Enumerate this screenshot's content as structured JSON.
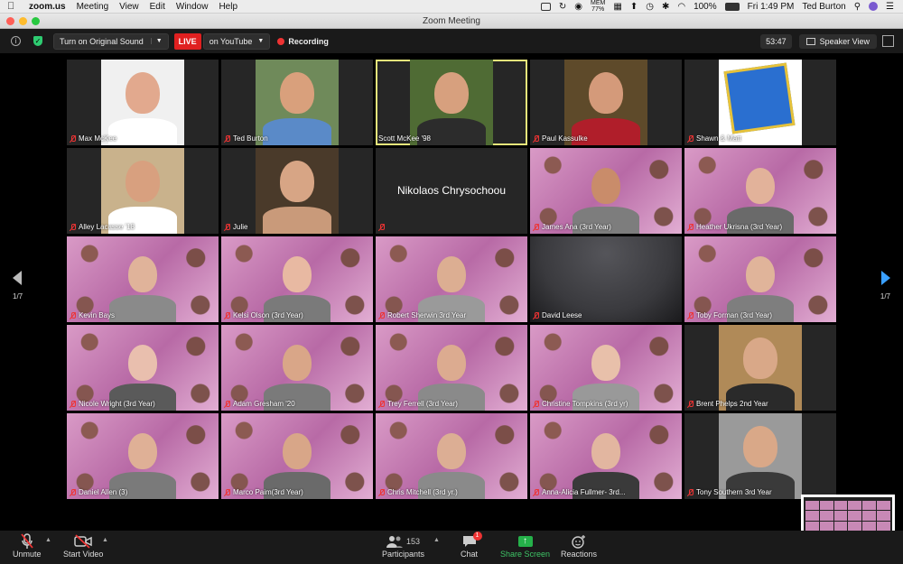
{
  "menubar": {
    "app": "zoom.us",
    "items": [
      "Meeting",
      "View",
      "Edit",
      "Window",
      "Help"
    ],
    "battery": "100%",
    "mem_label": "MEM",
    "mem_value": "77%",
    "clock": "Fri 1:49 PM",
    "user": "Ted Burton"
  },
  "window": {
    "title": "Zoom Meeting"
  },
  "topbar": {
    "original_sound": "Turn on Original Sound",
    "live": "LIVE",
    "youtube": "on YouTube",
    "recording": "Recording",
    "timer": "53:47",
    "speaker_view": "Speaker View"
  },
  "participants": [
    {
      "name": "Max McKee",
      "style": "photo",
      "muted": true,
      "active": false,
      "bg": "#f0f0f0",
      "skin": "#e2a98e",
      "shirt": "#ffffff"
    },
    {
      "name": "Ted Burton",
      "style": "photo",
      "muted": true,
      "active": false,
      "bg": "#6f8a5a",
      "skin": "#d9a07c",
      "shirt": "#5a8ac8"
    },
    {
      "name": "Scott McKee '98",
      "style": "photo",
      "muted": false,
      "active": true,
      "bg": "#4f6b34",
      "skin": "#d7a07e",
      "shirt": "#2c2c2c"
    },
    {
      "name": "Paul Kassulke",
      "style": "photo",
      "muted": true,
      "active": false,
      "bg": "#5e4a2a",
      "skin": "#d49a7a",
      "shirt": "#b01e2a"
    },
    {
      "name": "Shawn & Matt",
      "style": "blocks",
      "muted": true,
      "active": false,
      "bg": "#ffffff",
      "skin": "#e6c23a",
      "shirt": "#2a6fd0"
    },
    {
      "name": "Alley Lacasse '18",
      "style": "photo",
      "muted": true,
      "active": false,
      "bg": "#c9b28c",
      "skin": "#d8a07f",
      "shirt": "#ffffff"
    },
    {
      "name": "Julie",
      "style": "photo",
      "muted": true,
      "active": false,
      "bg": "#4a3a2a",
      "skin": "#d7a585",
      "shirt": "#c99a7a"
    },
    {
      "name": "Nikolaos Chrysochoou",
      "style": "text",
      "muted": true,
      "active": false,
      "bg": "#262626",
      "skin": "",
      "shirt": ""
    },
    {
      "name": "James Ana (3rd Year)",
      "style": "pink",
      "muted": true,
      "active": false,
      "bg": "",
      "skin": "#c98c6a",
      "shirt": "#7d7d7d"
    },
    {
      "name": "Heather Ukrisna (3rd Year)",
      "style": "pink",
      "muted": true,
      "active": false,
      "bg": "",
      "skin": "#e2b29a",
      "shirt": "#6a6a6a"
    },
    {
      "name": "Kevin Bays",
      "style": "pink",
      "muted": true,
      "active": false,
      "bg": "",
      "skin": "#e0b39a",
      "shirt": "#8a8a8a"
    },
    {
      "name": "Kelsi Olson (3rd Year)",
      "style": "pink",
      "muted": true,
      "active": false,
      "bg": "",
      "skin": "#e8b9a2",
      "shirt": "#7a7a7a"
    },
    {
      "name": "Robert Sherwin 3rd Year",
      "style": "pink",
      "muted": true,
      "active": false,
      "bg": "",
      "skin": "#dcae92",
      "shirt": "#9a9a9a"
    },
    {
      "name": "David Leese",
      "style": "dark",
      "muted": true,
      "active": false,
      "bg": "#3a3a3e",
      "skin": "",
      "shirt": ""
    },
    {
      "name": "Toby Forman (3rd Year)",
      "style": "pink",
      "muted": true,
      "active": false,
      "bg": "",
      "skin": "#e0b49a",
      "shirt": "#7e7e7e"
    },
    {
      "name": "Nicole Wright (3rd Year)",
      "style": "pink",
      "muted": true,
      "active": false,
      "bg": "",
      "skin": "#e9bfae",
      "shirt": "#5a5a5a"
    },
    {
      "name": "Adam Gresham '20",
      "style": "pink",
      "muted": true,
      "active": false,
      "bg": "",
      "skin": "#d9a688",
      "shirt": "#7a7a7a"
    },
    {
      "name": "Trey Ferrell (3rd Year)",
      "style": "pink",
      "muted": true,
      "active": false,
      "bg": "",
      "skin": "#dcab90",
      "shirt": "#8a8a8a"
    },
    {
      "name": "Christine Tompkins (3rd yr)",
      "style": "pink",
      "muted": true,
      "active": false,
      "bg": "",
      "skin": "#e8c0aa",
      "shirt": "#999999"
    },
    {
      "name": "Brent Phelps 2nd Year",
      "style": "photo",
      "muted": true,
      "active": false,
      "bg": "#b08a58",
      "skin": "#d9a888",
      "shirt": "#2a2a2a"
    },
    {
      "name": "Daniel Allen (3)",
      "style": "pink",
      "muted": true,
      "active": false,
      "bg": "",
      "skin": "#dfb096",
      "shirt": "#7a7a7a"
    },
    {
      "name": "Marco Paim(3rd Year)",
      "style": "pink",
      "muted": true,
      "active": false,
      "bg": "",
      "skin": "#d8a688",
      "shirt": "#6a6a6a"
    },
    {
      "name": "Chris Mitchell (3rd yr.)",
      "style": "pink",
      "muted": true,
      "active": false,
      "bg": "",
      "skin": "#dcae94",
      "shirt": "#8a8a8a"
    },
    {
      "name": "Anna-Alicia Fullmer- 3rd...",
      "style": "pink",
      "muted": true,
      "active": false,
      "bg": "",
      "skin": "#e2b6a0",
      "shirt": "#3a3a3a"
    },
    {
      "name": "Tony Southern 3rd Year",
      "style": "photo",
      "muted": true,
      "active": false,
      "bg": "#9a9a9a",
      "skin": "#d9a888",
      "shirt": "#3a3a3a"
    }
  ],
  "pagination": {
    "left": "1/7",
    "right": "1/7"
  },
  "bottombar": {
    "unmute": "Unmute",
    "start_video": "Start Video",
    "participants_label": "Participants",
    "participants_count": "153",
    "chat": "Chat",
    "chat_badge": "1",
    "share": "Share Screen",
    "reactions": "Reactions"
  }
}
